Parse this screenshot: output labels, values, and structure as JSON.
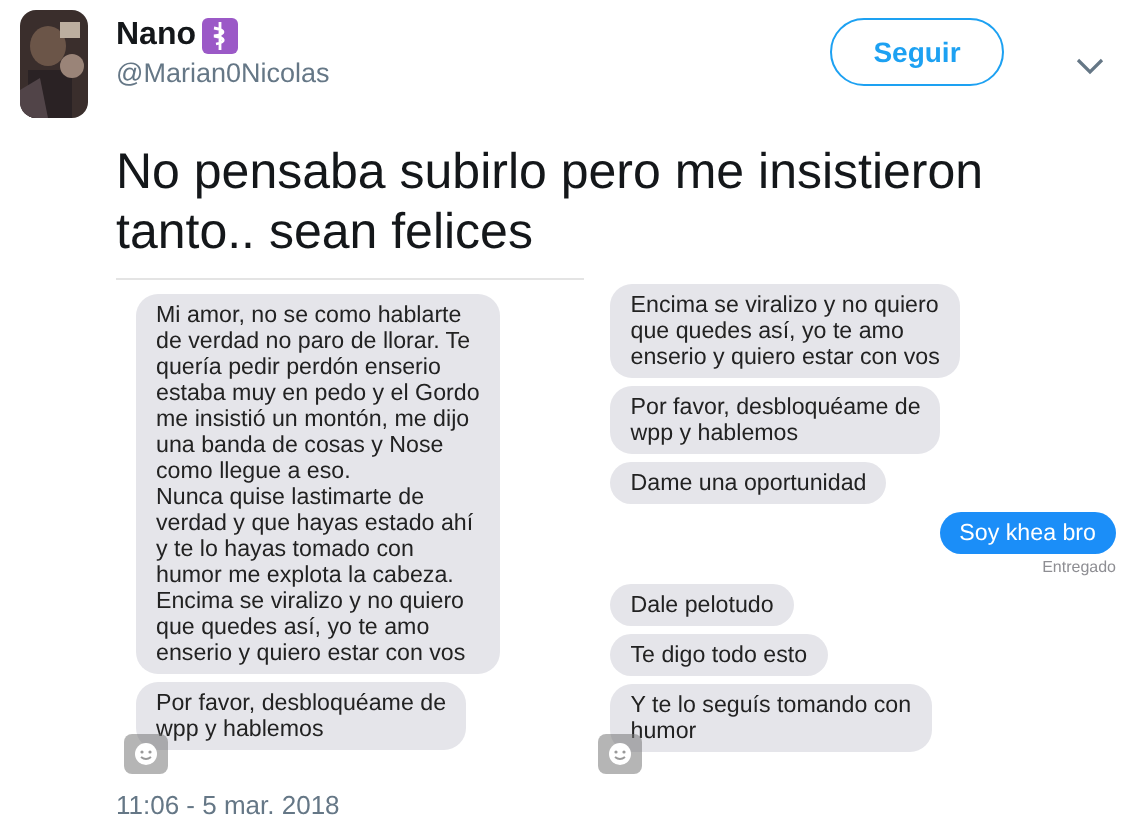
{
  "author": {
    "name": "Nano",
    "handle": "@Marian0Nicolas"
  },
  "follow_button": {
    "label": "Seguir"
  },
  "tweet_text": "No pensaba subirlo pero me insistieron tanto.. sean felices",
  "images": [
    {
      "messages": [
        {
          "kind": "received",
          "text": "Mi amor, no se como hablarte\nde verdad no paro de llorar. Te\nquería pedir perdón enserio\nestaba muy en pedo y el Gordo\nme insistió un montón, me dijo\nuna banda de cosas y Nose\ncomo llegue a eso.\nNunca quise lastimarte de\nverdad y que hayas estado ahí\ny te lo hayas tomado con\nhumor me explota la cabeza.\nEncima se viralizo y no quiero\nque quedes así, yo te amo\nenserio y quiero estar con vos"
        },
        {
          "kind": "received",
          "text": "Por favor, desbloquéame de\nwpp y hablemos"
        }
      ]
    },
    {
      "messages": [
        {
          "kind": "received",
          "text": "Encima se viralizo y no quiero\nque quedes así, yo te amo\nenserio y quiero estar con vos"
        },
        {
          "kind": "received",
          "text": "Por favor, desbloquéame de\nwpp y hablemos"
        },
        {
          "kind": "received",
          "text": "Dame una oportunidad"
        },
        {
          "kind": "sent",
          "text": "Soy khea bro",
          "status": "Entregado"
        },
        {
          "kind": "received",
          "text": "Dale pelotudo"
        },
        {
          "kind": "received",
          "text": "Te digo todo esto"
        },
        {
          "kind": "received",
          "text": "Y te lo seguís tomando con\nhumor"
        }
      ]
    }
  ],
  "timestamp": "11:06 - 5 mar. 2018"
}
